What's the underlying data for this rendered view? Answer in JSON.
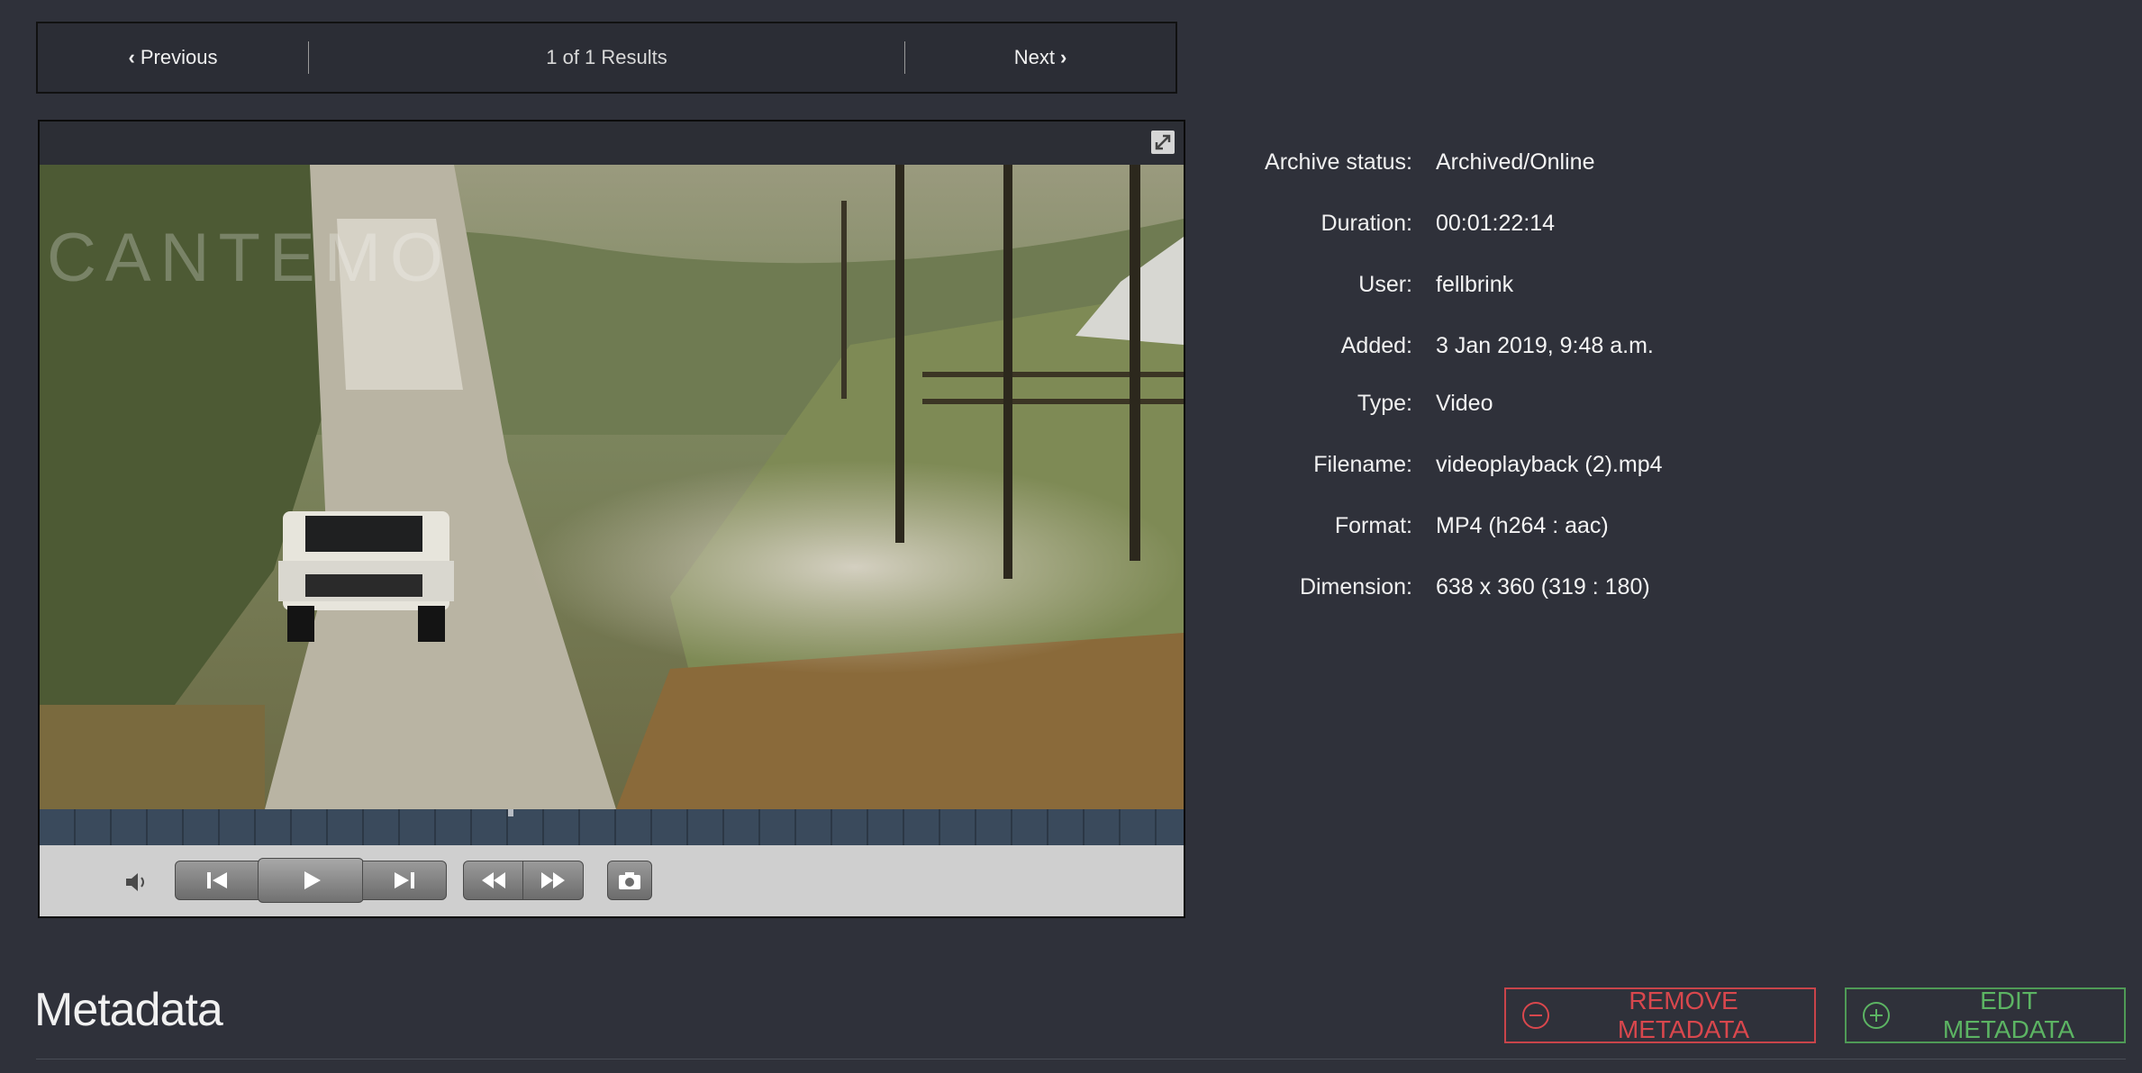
{
  "pager": {
    "previous_label": "Previous",
    "next_label": "Next",
    "results_text": "1 of 1 Results"
  },
  "player": {
    "watermark": "CANTEMO",
    "icons": [
      "fullscreen-icon",
      "volume-icon",
      "skip-back-icon",
      "play-icon",
      "skip-forward-icon",
      "rewind-icon",
      "fast-forward-icon",
      "snapshot-icon"
    ]
  },
  "info": {
    "rows": [
      {
        "label": "Archive status:",
        "value": "Archived/Online"
      },
      {
        "label": "Duration:",
        "value": "00:01:22:14"
      },
      {
        "label": "User:",
        "value": "fellbrink"
      },
      {
        "label": "Added:",
        "value": "3 Jan 2019, 9:48 a.m."
      },
      {
        "label": "Type:",
        "value": "Video"
      },
      {
        "label": "Filename:",
        "value": "videoplayback (2).mp4"
      },
      {
        "label": "Format:",
        "value": "MP4 (h264 : aac)"
      },
      {
        "label": "Dimension:",
        "value": "638 x 360 (319 : 180)"
      }
    ]
  },
  "metadata": {
    "title": "Metadata",
    "remove_label": "REMOVE METADATA",
    "edit_label": "EDIT METADATA"
  },
  "colors": {
    "background": "#2f313a",
    "remove_accent": "#d9474d",
    "edit_accent": "#5cb463"
  }
}
